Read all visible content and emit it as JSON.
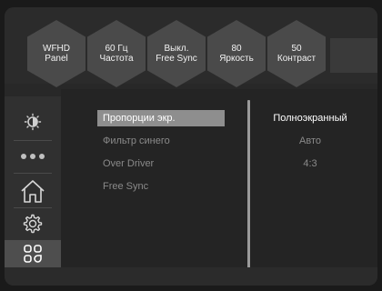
{
  "status_tiles": [
    {
      "line1": "WFHD",
      "line2": "Panel"
    },
    {
      "line1": "60 Гц",
      "line2": "Частота"
    },
    {
      "line1": "Выкл.",
      "line2": "Free Sync"
    },
    {
      "line1": "80",
      "line2": "Яркость"
    },
    {
      "line1": "50",
      "line2": "Контраст"
    }
  ],
  "sidebar": {
    "items": [
      {
        "icon": "brightness-icon"
      },
      {
        "icon": "dots-icon"
      },
      {
        "icon": "home-icon"
      },
      {
        "icon": "gear-icon"
      },
      {
        "icon": "grid-icon",
        "active": true
      }
    ]
  },
  "menu": {
    "items": [
      {
        "label": "Пропорции экр.",
        "selected": true
      },
      {
        "label": "Фильтр синего"
      },
      {
        "label": "Over Driver"
      },
      {
        "label": "Free Sync"
      }
    ]
  },
  "options": {
    "items": [
      {
        "label": "Полноэкранный",
        "current": true
      },
      {
        "label": "Авто"
      },
      {
        "label": "4:3"
      }
    ]
  },
  "colors": {
    "background": "#282828",
    "selected_bg": "#8e8e8e",
    "tile": "#4a4a4a",
    "inactive_text": "#8a8a8a"
  }
}
